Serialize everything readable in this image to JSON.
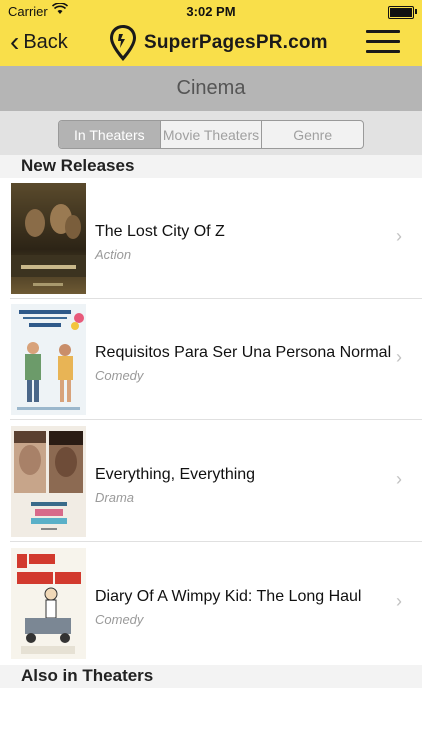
{
  "status_bar": {
    "carrier": "Carrier",
    "time": "3:02 PM"
  },
  "nav": {
    "back_label": "Back",
    "logo_text": "SuperPagesPR.com"
  },
  "page": {
    "title": "Cinema"
  },
  "segments": [
    {
      "label": "In Theaters",
      "selected": true
    },
    {
      "label": "Movie Theaters",
      "selected": false
    },
    {
      "label": "Genre",
      "selected": false
    }
  ],
  "sections": [
    {
      "header": "New Releases"
    },
    {
      "header": "Also in Theaters"
    }
  ],
  "movies": [
    {
      "title": "The Lost City Of Z",
      "genre": "Action"
    },
    {
      "title": "Requisitos Para Ser Una Persona Normal",
      "genre": "Comedy"
    },
    {
      "title": "Everything, Everything",
      "genre": "Drama"
    },
    {
      "title": "Diary Of A Wimpy Kid: The Long Haul",
      "genre": "Comedy"
    }
  ],
  "colors": {
    "nav_bg": "#f9df4a",
    "title_band": "#b5b5b5",
    "segment_active": "#b3b3b3",
    "genre_text": "#9a9a9a"
  }
}
